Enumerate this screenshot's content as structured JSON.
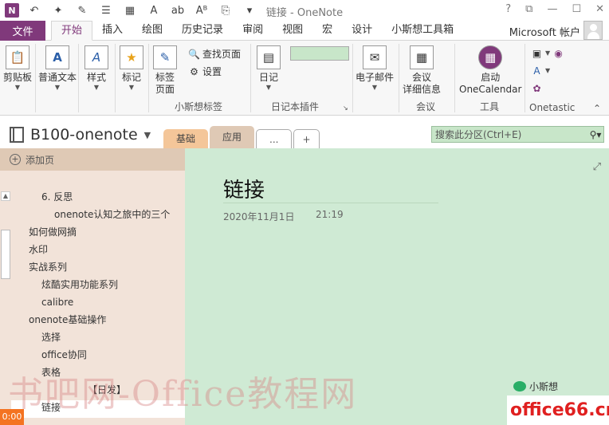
{
  "window": {
    "title": "链接 - OneNote",
    "controls": [
      "?",
      "⧉",
      "—",
      "☐",
      "✕"
    ]
  },
  "quick_access": {
    "icons": [
      "onenote-logo-icon",
      "back-icon",
      "dock-icon",
      "format-painter-icon",
      "list-icon",
      "table-icon",
      "font-icon",
      "spelling-icon",
      "case-icon",
      "attach-icon",
      "more-icon"
    ],
    "logo_text": "N"
  },
  "tabs": {
    "file": "文件",
    "items": [
      "开始",
      "插入",
      "绘图",
      "历史记录",
      "审阅",
      "视图",
      "宏",
      "设计",
      "小斯想工具箱"
    ],
    "active": "开始",
    "account": "Microsoft 帐户"
  },
  "ribbon": {
    "clipboard": "剪贴板",
    "basic_text": "普通文本",
    "styles": "样式",
    "tags": "标记",
    "tag_page_line1": "标签",
    "tag_page_line2": "页面",
    "find_page": "查找页面",
    "settings": "设置",
    "group_xiaosi_tags": "小斯想标签",
    "diary": "日记",
    "group_diary_plugin": "日记本插件",
    "email": "电子邮件",
    "meeting_line1": "会议",
    "meeting_line2": "详细信息",
    "group_meeting": "会议",
    "launch_line1": "启动",
    "launch_line2": "OneCalendar",
    "group_tools": "工具",
    "group_onetastic": "Onetastic"
  },
  "notebook": {
    "name": "B100-onenote",
    "sections": [
      "基础",
      "应用",
      "...",
      "+"
    ],
    "active_section": "应用",
    "search_placeholder": "搜索此分区(Ctrl+E)"
  },
  "pages": {
    "add_page": "添加页",
    "items": [
      {
        "label": "6. 反思",
        "level": 2
      },
      {
        "label": "onenote认知之旅中的三个",
        "level": 3
      },
      {
        "label": "如何做网摘",
        "level": 1
      },
      {
        "label": "水印",
        "level": 1
      },
      {
        "label": "实战系列",
        "level": 1
      },
      {
        "label": "炫酷实用功能系列",
        "level": 2
      },
      {
        "label": "calibre",
        "level": 2
      },
      {
        "label": "onenote基础操作",
        "level": 1
      },
      {
        "label": "选择",
        "level": 2
      },
      {
        "label": "office协同",
        "level": 2
      },
      {
        "label": "表格",
        "level": 2
      },
      {
        "label": "【日发】",
        "level": 3
      },
      {
        "label": "链接",
        "level": 2,
        "selected": true
      }
    ]
  },
  "page": {
    "title": "链接",
    "date": "2020年11月1日",
    "time": "21:19"
  },
  "overlay": {
    "time_badge": "0:00",
    "watermark": "书吧网-Office教程网",
    "wechat": "小斯想",
    "site": "office66.cn"
  },
  "colors": {
    "onenote_purple": "#80397b",
    "page_green": "#cfead4",
    "pane_bg": "#f2e3d9",
    "tab_orange": "#f4c699",
    "badge_orange": "#f47321"
  }
}
